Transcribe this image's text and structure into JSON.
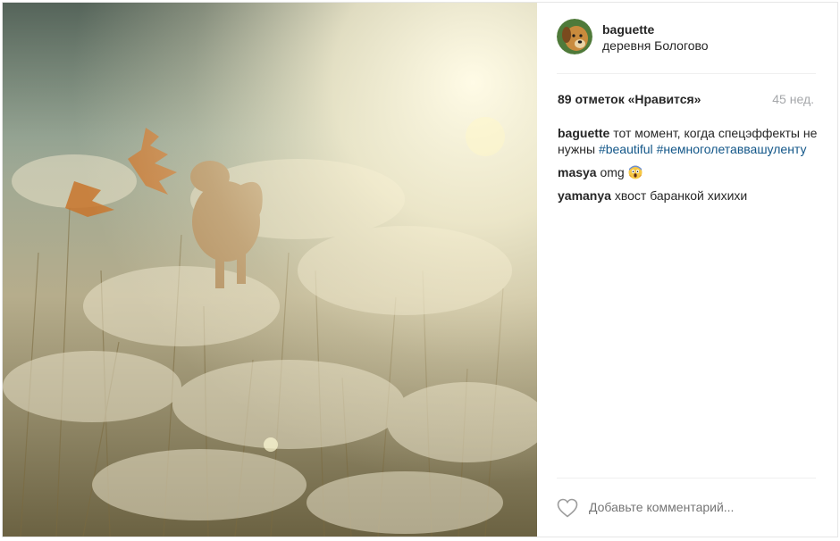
{
  "post": {
    "username": "baguette",
    "location": "деревня Бологово",
    "likes": "89 отметок «Нравится»",
    "time_ago": "45 нед.",
    "caption": {
      "author": "baguette",
      "text": "тот момент, когда спецэффекты не нужны",
      "tags": [
        "#beautiful",
        "#немноголетаввашуленту"
      ]
    },
    "comments": [
      {
        "author": "masya",
        "text": "omg"
      },
      {
        "author": "yamanya",
        "text": "хвост баранкой хихихи"
      }
    ],
    "comment_placeholder": "Добавьте комментарий..."
  },
  "icons": {
    "like": "heart-outline-icon",
    "emoji": "face-screaming-in-fear-emoji"
  },
  "colors": {
    "hashtag": "#125688",
    "muted": "#a5a7aa"
  }
}
